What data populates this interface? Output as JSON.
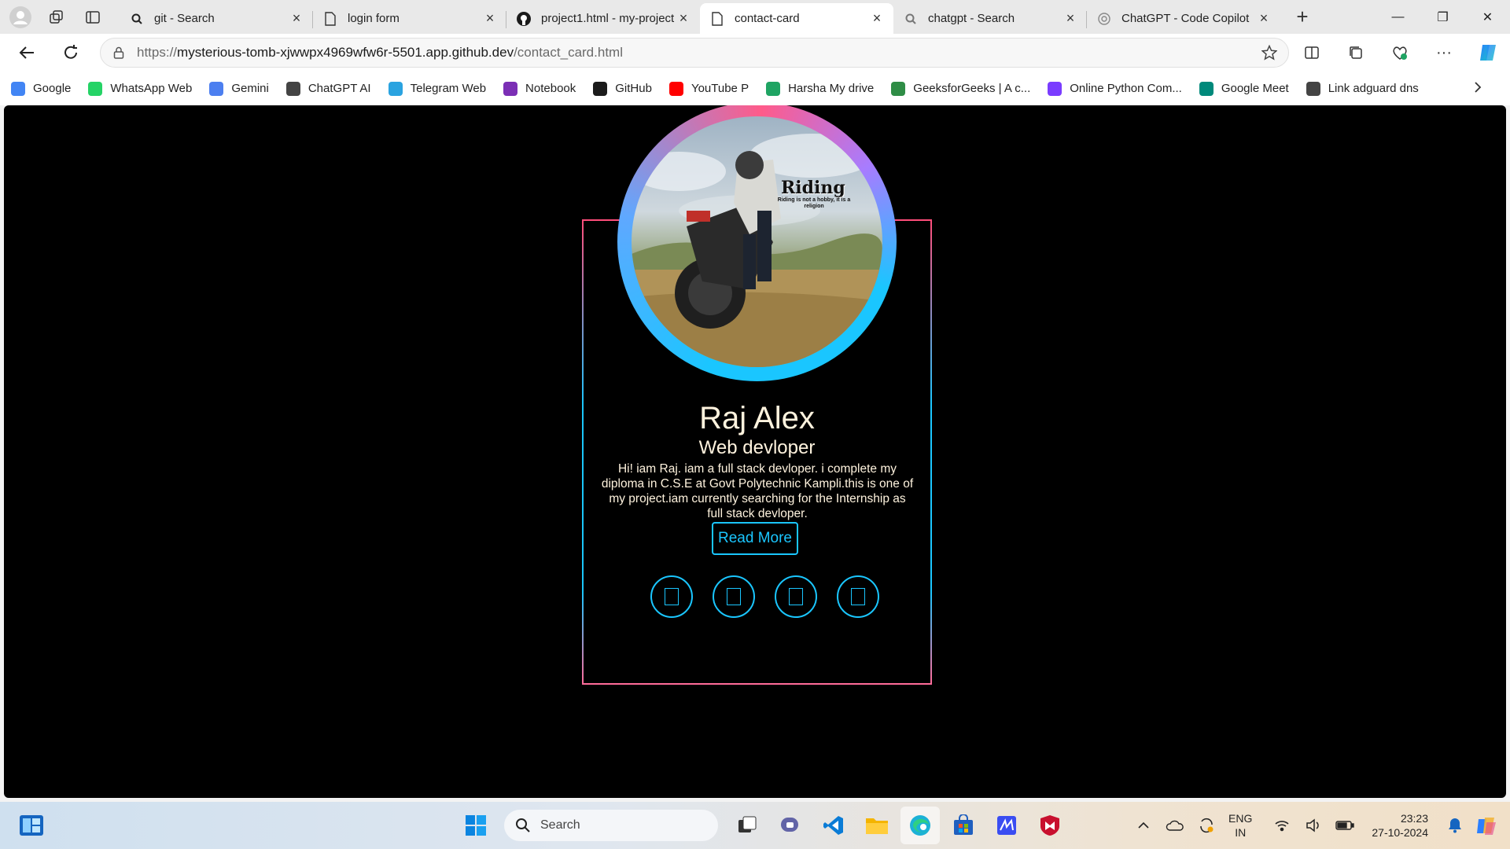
{
  "browser": {
    "tabs": [
      {
        "title": "git - Search",
        "icon": "search-icon",
        "active": false
      },
      {
        "title": "login form",
        "icon": "page-icon",
        "active": false
      },
      {
        "title": "project1.html - my-project",
        "icon": "github-icon",
        "active": false
      },
      {
        "title": "contact-card",
        "icon": "page-icon",
        "active": true
      },
      {
        "title": "chatgpt - Search",
        "icon": "search-icon",
        "active": false
      },
      {
        "title": "ChatGPT - Code Copilot",
        "icon": "chatgpt-icon",
        "active": false
      }
    ],
    "url": {
      "scheme": "https://",
      "host": "mysterious-tomb-xjwwpx4969wfw6r-5501.app.github.dev",
      "path": "/contact_card.html"
    },
    "bookmarks": [
      {
        "label": "Google",
        "icon": "google-icon",
        "color": "#4285f4"
      },
      {
        "label": "WhatsApp Web",
        "icon": "whatsapp-icon",
        "color": "#25d366"
      },
      {
        "label": "Gemini",
        "icon": "gemini-icon",
        "color": "#4c7ff0"
      },
      {
        "label": "ChatGPT AI",
        "icon": "chatgpt-icon",
        "color": "#444444"
      },
      {
        "label": "Telegram Web",
        "icon": "telegram-icon",
        "color": "#2aa3e0"
      },
      {
        "label": "Notebook",
        "icon": "onenote-icon",
        "color": "#7b2fb5"
      },
      {
        "label": "GitHub",
        "icon": "github-icon",
        "color": "#1b1b1b"
      },
      {
        "label": "YouTube P",
        "icon": "youtube-icon",
        "color": "#ff0000"
      },
      {
        "label": "Harsha My drive",
        "icon": "drive-icon",
        "color": "#1fa463"
      },
      {
        "label": "GeeksforGeeks | A c...",
        "icon": "gfg-icon",
        "color": "#2f8d46"
      },
      {
        "label": "Online Python Com...",
        "icon": "python-icon",
        "color": "#7a3cff"
      },
      {
        "label": "Google Meet",
        "icon": "meet-icon",
        "color": "#00897b"
      },
      {
        "label": "Link adguard dns",
        "icon": "page-icon",
        "color": "#444444"
      }
    ]
  },
  "card": {
    "name": "Raj Alex",
    "role": "Web devloper",
    "bio": "Hi! iam Raj. iam a full stack devloper. i complete my diploma in C.S.E at Govt Polytechnic Kampli.this is one of my project.iam currently searching for the Internship as full stack devloper.",
    "button": "Read More",
    "photo_caption": "Riding",
    "photo_subcaption": "Riding is not a hobby, it is a religion",
    "social_icons": [
      "social-icon-1",
      "social-icon-2",
      "social-icon-3",
      "social-icon-4"
    ],
    "accent": "#1ac6ff",
    "accent_pink": "#ff4d7a",
    "text_color": "#fff3de"
  },
  "taskbar": {
    "search_placeholder": "Search",
    "apps": [
      "task-view-icon",
      "teams-icon",
      "vscode-icon",
      "file-explorer-icon",
      "edge-icon",
      "store-icon",
      "app-icon",
      "mcafee-icon"
    ],
    "lang_top": "ENG",
    "lang_bottom": "IN",
    "time": "23:23",
    "date": "27-10-2024"
  }
}
